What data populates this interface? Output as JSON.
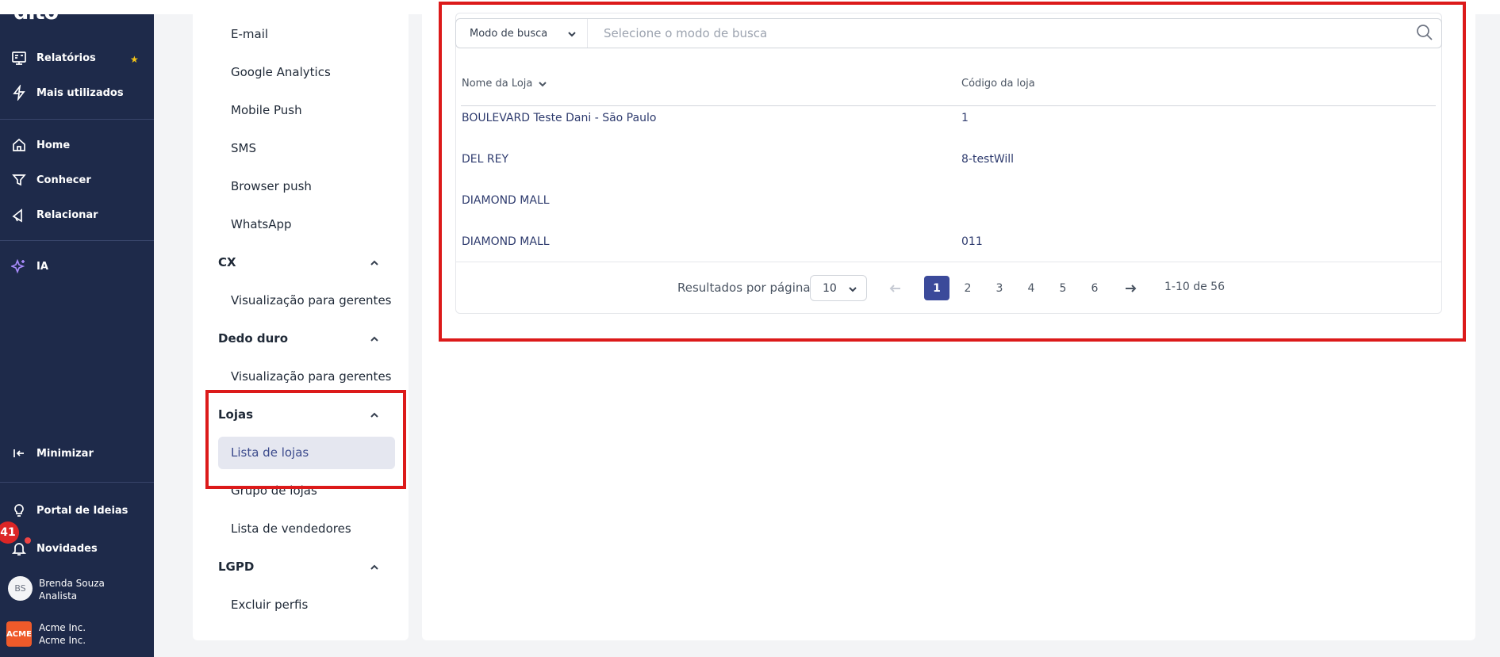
{
  "leftnav": {
    "logo": "dito",
    "items": [
      {
        "label": "Relatórios",
        "icon": "reports-icon"
      },
      {
        "label": "Mais utilizados",
        "icon": "lightning-icon"
      },
      {
        "label": "Home",
        "icon": "home-icon"
      },
      {
        "label": "Conhecer",
        "icon": "filter-icon"
      },
      {
        "label": "Relacionar",
        "icon": "megaphone-icon"
      },
      {
        "label": "IA",
        "icon": "sparkle-icon"
      },
      {
        "label": "Minimizar",
        "icon": "collapse-icon"
      },
      {
        "label": "Portal de Ideias",
        "icon": "lightbulb-icon"
      },
      {
        "label": "Novidades",
        "icon": "bell-icon"
      }
    ],
    "notifications_count": "41",
    "user": {
      "initials": "BS",
      "name": "Brenda Souza",
      "role": "Analista"
    },
    "company": {
      "logo_text": "ACME",
      "name": "Acme Inc.",
      "sub": "Acme Inc."
    }
  },
  "subnav": {
    "items_top": [
      "E-mail",
      "Google Analytics",
      "Mobile Push",
      "SMS",
      "Browser push",
      "WhatsApp"
    ],
    "groups": [
      {
        "title": "CX",
        "items": [
          "Visualização para gerentes"
        ]
      },
      {
        "title": "Dedo duro",
        "items": [
          "Visualização para gerentes"
        ]
      },
      {
        "title": "Lojas",
        "items": [
          "Lista de lojas",
          "Grupo de lojas",
          "Lista de vendedores"
        ]
      },
      {
        "title": "LGPD",
        "items": [
          "Excluir perfis"
        ]
      }
    ]
  },
  "search": {
    "mode_label": "Modo de busca",
    "placeholder": "Selecione o modo de busca"
  },
  "table": {
    "columns": [
      "Nome da Loja",
      "Código da loja"
    ],
    "rows": [
      [
        "BOULEVARD Teste Dani - São Paulo",
        "1"
      ],
      [
        "DEL REY",
        "8-testWill"
      ],
      [
        "DIAMOND MALL",
        ""
      ],
      [
        "DIAMOND MALL",
        "011"
      ]
    ]
  },
  "pagination": {
    "per_page_label": "Resultados por página",
    "per_page_value": "10",
    "pages": [
      "1",
      "2",
      "3",
      "4",
      "5",
      "6"
    ],
    "current_page": "1",
    "range": "1-10 de 56"
  },
  "colors": {
    "nav_bg": "#1e2a4a",
    "accent": "#3b4a9a",
    "highlight": "#dc1a1a"
  }
}
